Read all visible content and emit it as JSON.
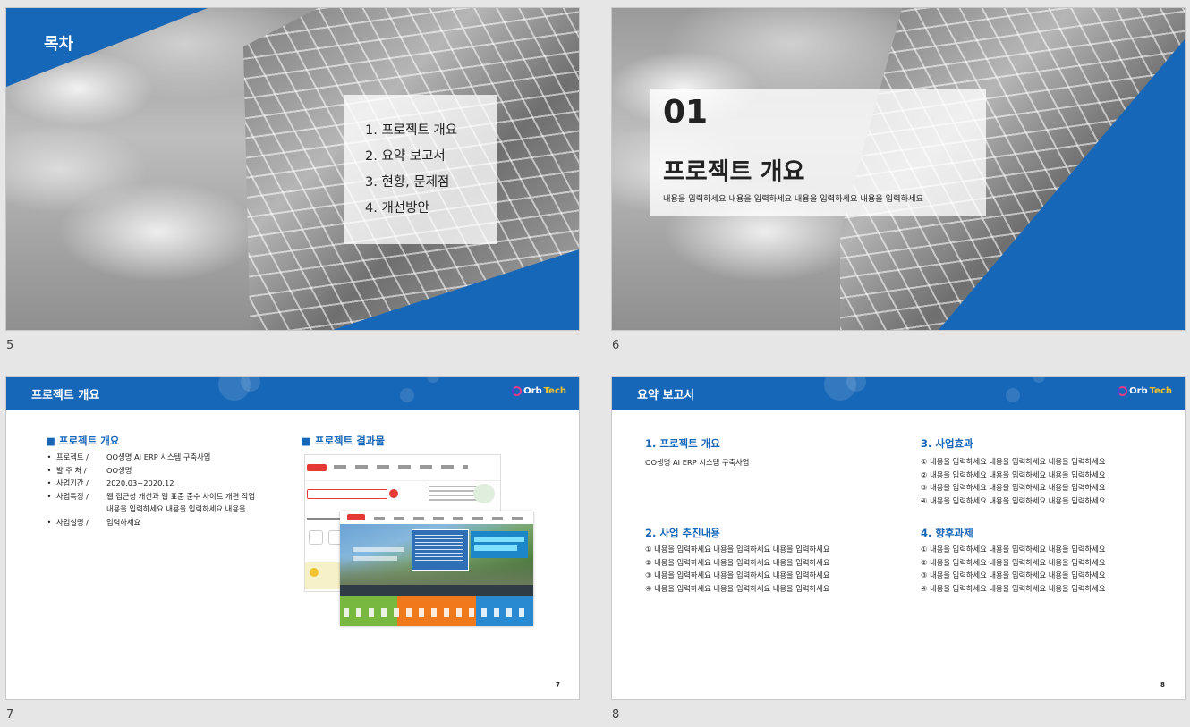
{
  "slides": [
    {
      "number": "5",
      "title": "목차",
      "toc": [
        "1. 프로젝트 개요",
        "2. 요약 보고서",
        "3. 현황, 문제점",
        "4. 개선방안"
      ]
    },
    {
      "number": "6",
      "big_number": "01",
      "heading": "프로젝트 개요",
      "subtitle": "내용을 입력하세요 내용을 입력하세요 내용을 입력하세요 내용을 입력하세요"
    },
    {
      "number": "7",
      "header": "프로젝트 개요",
      "page": "7",
      "overview_title": "■ 프로젝트 개요",
      "results_title": "■ 프로젝트 결과물",
      "items": [
        {
          "key": "프로젝트 /",
          "value": "OO생명 AI ERP 시스템 구축사업"
        },
        {
          "key": "발 주 처 /",
          "value": "OO생명"
        },
        {
          "key": "사업기간 /",
          "value": "2020.03~2020.12"
        },
        {
          "key": "사업특징 /",
          "value": "웹 접근성 개선과 웹 표준 준수 사이트 개편 작업"
        },
        {
          "key": "",
          "value": "내용을 입력하세요 내용을 입력하세요 내용을"
        },
        {
          "key": "사업설명 /",
          "value": "입력하세요"
        }
      ]
    },
    {
      "number": "8",
      "header": "요약 보고서",
      "page": "8",
      "sections": [
        {
          "title": "1. 프로젝트 개요",
          "lines": [
            "OO생명 AI ERP 시스템 구축사업"
          ]
        },
        {
          "title": "2. 사업 추진내용",
          "lines": [
            "① 내용을 입력하세요 내용을 입력하세요 내용을 입력하세요",
            "② 내용을 입력하세요 내용을 입력하세요 내용을 입력하세요",
            "③ 내용을 입력하세요 내용을 입력하세요 내용을 입력하세요",
            "④ 내용을 입력하세요 내용을 입력하세요 내용을 입력하세요"
          ]
        },
        {
          "title": "3. 사업효과",
          "lines": [
            "① 내용을 입력하세요 내용을 입력하세요 내용을 입력하세요",
            "② 내용을 입력하세요 내용을 입력하세요 내용을 입력하세요",
            "③ 내용을 입력하세요 내용을 입력하세요 내용을 입력하세요",
            "④ 내용을 입력하세요 내용을 입력하세요 내용을 입력하세요"
          ]
        },
        {
          "title": "4. 향후과제",
          "lines": [
            "① 내용을 입력하세요 내용을 입력하세요 내용을 입력하세요",
            "② 내용을 입력하세요 내용을 입력하세요 내용을 입력하세요",
            "③ 내용을 입력하세요 내용을 입력하세요 내용을 입력하세요",
            "④ 내용을 입력하세요 내용을 입력하세요 내용을 입력하세요"
          ]
        }
      ]
    }
  ],
  "logo": {
    "part1": "Orb",
    "part2": "Tech"
  },
  "colors": {
    "accent": "#1767b8",
    "background": "#e6e6e6"
  }
}
